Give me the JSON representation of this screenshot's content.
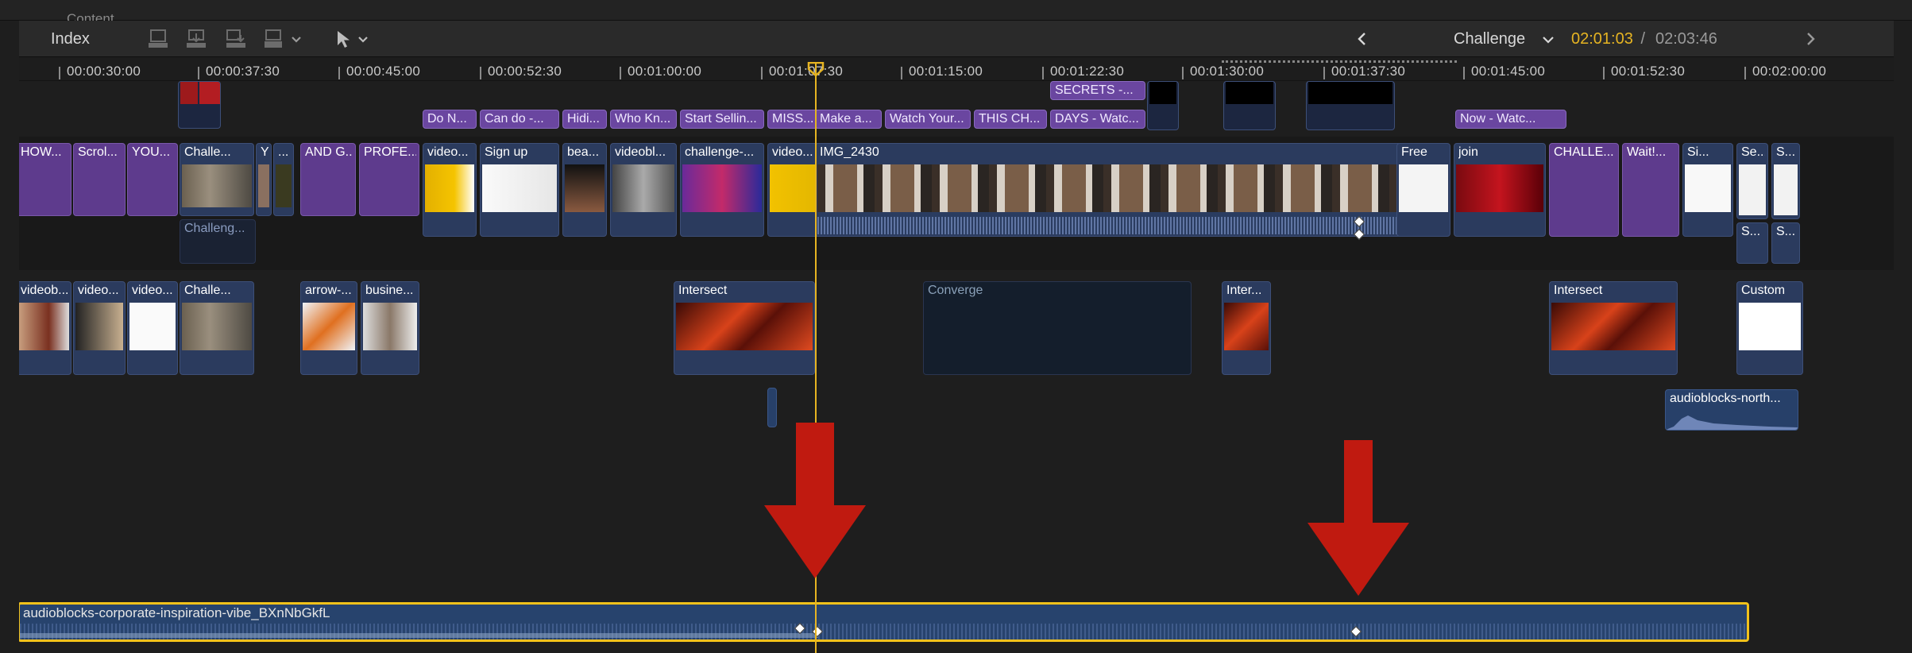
{
  "window": {
    "cut_label": "Content"
  },
  "toolbar": {
    "index_label": "Index",
    "project_name": "Challenge",
    "current_time": "02:01:03",
    "separator": " / ",
    "total_time": "02:03:46",
    "nav_back_icon": "chevron-left-icon",
    "nav_forward_icon": "chevron-right-icon"
  },
  "colors": {
    "accent": "#e6b422",
    "title_clip": "#5e3b8d",
    "video_clip": "#2b3b5e",
    "marker_arrow": "#c01a10",
    "selection": "#f2c21b"
  },
  "ruler": {
    "ticks": [
      "00:00:30:00",
      "00:00:37:30",
      "00:00:45:00",
      "00:00:52:30",
      "00:01:00:00",
      "00:01:07:30",
      "00:01:15:00",
      "00:01:22:30",
      "00:01:30:00",
      "00:01:37:30",
      "00:01:45:00",
      "00:01:52:30",
      "00:02:00:00"
    ]
  },
  "titles_row": {
    "top_chips": [
      "SECRETS -..."
    ],
    "chips": [
      "Do N...",
      "Can do -...",
      "Hidi...",
      "Who Kn...",
      "Start Sellin...",
      "MISS...",
      "Make a...",
      "Watch Your...",
      "THIS CH...",
      "DAYS - Watc...",
      "Now - Watc..."
    ]
  },
  "primary_row": {
    "clips": [
      "HOW...",
      "Scrol...",
      "YOU...",
      "Challe...",
      "Y",
      "...",
      "AND G...",
      "PROFE...",
      "video...",
      "Sign up",
      "bea...",
      "videobl...",
      "challenge-...",
      "video...",
      "IMG_2430",
      "Free",
      "join",
      "CHALLE...",
      "Wait!...",
      "Si...",
      "Se...",
      "S..."
    ],
    "sub_clips": [
      "Challeng...",
      "S...",
      "S..."
    ]
  },
  "broll_row": {
    "clips": [
      "videob...",
      "video...",
      "video...",
      "Challe...",
      "arrow-...",
      "busine...",
      "Intersect",
      "Converge",
      "Inter...",
      "Intersect",
      "Custom"
    ]
  },
  "audio_row": {
    "clip": "audioblocks-north..."
  },
  "main_audio": {
    "label": "audioblocks-corporate-inspiration-vibe_BXnNbGkfL"
  }
}
